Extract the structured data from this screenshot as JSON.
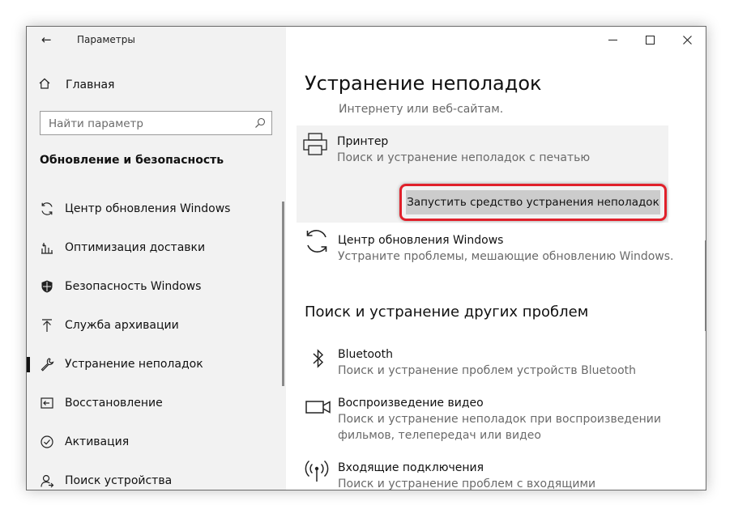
{
  "window": {
    "title": "Параметры",
    "back_glyph": "←",
    "min_glyph": "—",
    "max_glyph": "☐",
    "close_glyph": "✕"
  },
  "sidebar": {
    "home_label": "Главная",
    "search_placeholder": "Найти параметр",
    "section_title": "Обновление и безопасность",
    "items": [
      {
        "label": "Центр обновления Windows",
        "icon": "refresh-icon"
      },
      {
        "label": "Оптимизация доставки",
        "icon": "delivery-icon"
      },
      {
        "label": "Безопасность Windows",
        "icon": "shield-icon"
      },
      {
        "label": "Служба архивации",
        "icon": "upload-icon"
      },
      {
        "label": "Устранение неполадок",
        "icon": "wrench-icon",
        "active": true
      },
      {
        "label": "Восстановление",
        "icon": "recovery-icon"
      },
      {
        "label": "Активация",
        "icon": "check-circle-icon"
      },
      {
        "label": "Поиск устройства",
        "icon": "person-icon"
      }
    ]
  },
  "main": {
    "title": "Устранение неполадок",
    "clipped_text": "Интернету или веб-сайтам.",
    "printer": {
      "title": "Принтер",
      "desc": "Поиск и устранение неполадок с печатью",
      "button": "Запустить средство устранения неполадок"
    },
    "windows_update": {
      "title": "Центр обновления Windows",
      "desc": "Устраните проблемы, мешающие обновлению Windows."
    },
    "other_title": "Поиск и устранение других проблем",
    "bluetooth": {
      "title": "Bluetooth",
      "desc": "Поиск и устранение проблем устройств Bluetooth"
    },
    "video": {
      "title": "Воспроизведение видео",
      "desc1": "Поиск и устранение неполадок при воспроизведении",
      "desc2": "фильмов, телепередач или видео"
    },
    "incoming": {
      "title": "Входящие подключения",
      "desc": "Поиск и устранение проблем с входящими"
    }
  },
  "colors": {
    "highlight": "#e0202a",
    "sidebar_bg": "#f2f2f2",
    "button_bg": "#cccccc"
  }
}
